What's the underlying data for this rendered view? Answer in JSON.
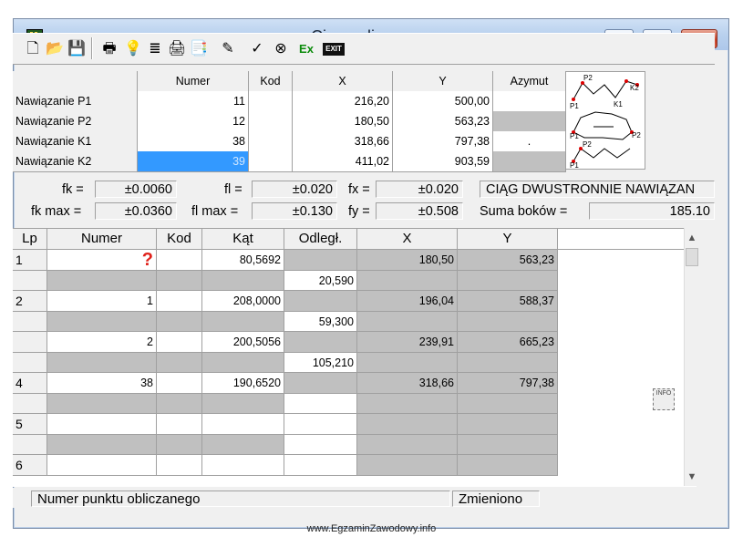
{
  "window": {
    "title": "Ciąg poligonowy",
    "controls": {
      "minimize": "–",
      "maximize": "□",
      "close": "✕"
    }
  },
  "toolbar": {
    "icons": [
      "new-file-icon",
      "open-folder-icon",
      "save-icon",
      "print-setup-icon",
      "bulb-icon",
      "list-icon",
      "printer-icon",
      "export-icon",
      "pencil-icon",
      "check-icon",
      "stop-icon",
      "excel-icon",
      "exit-icon"
    ],
    "exit_label": "EXIT",
    "excel_label": "Ex"
  },
  "connections": {
    "headers": {
      "numer": "Numer",
      "kod": "Kod",
      "x": "X",
      "y": "Y",
      "azymut": "Azymut"
    },
    "rows": [
      {
        "label": "Nawiązanie P1",
        "numer": "11",
        "kod": "",
        "x": "216,20",
        "y": "500,00",
        "azymut": ""
      },
      {
        "label": "Nawiązanie P2",
        "numer": "12",
        "kod": "",
        "x": "180,50",
        "y": "563,23",
        "azymut": ""
      },
      {
        "label": "Nawiązanie K1",
        "numer": "38",
        "kod": "",
        "x": "318,66",
        "y": "797,38",
        "azymut": "."
      },
      {
        "label": "Nawiązanie K2",
        "numer": "39",
        "kod": "",
        "x": "411,02",
        "y": "903,59",
        "azymut": ""
      }
    ],
    "diagram_labels": {
      "p1": "P1",
      "p2": "P2",
      "k1": "K1",
      "k2": "K2"
    }
  },
  "stats": {
    "fk_label": "fk =",
    "fk": "±0.0060",
    "fl_label": "fl =",
    "fl": "±0.020",
    "fx_label": "fx =",
    "fx": "±0.020",
    "type": "CIĄG DWUSTRONNIE NAWIĄZAN",
    "fkmax_label": "fk max =",
    "fkmax": "±0.0360",
    "flmax_label": "fl max =",
    "flmax": "±0.130",
    "fy_label": "fy =",
    "fy": "±0.508",
    "suma_label": "Suma boków =",
    "suma": "185.10"
  },
  "traverse": {
    "headers": {
      "lp": "Lp",
      "numer": "Numer",
      "kod": "Kod",
      "kat": "Kąt",
      "odleg": "Odległ.",
      "x": "X",
      "y": "Y"
    },
    "rows": [
      {
        "lp": "1",
        "numer": "?",
        "kod": "",
        "kat": "80,5692",
        "odleg": "",
        "x": "180,50",
        "y": "563,23"
      },
      {
        "lp": "",
        "numer": "",
        "kod": "",
        "kat": "",
        "odleg": "20,590",
        "x": "",
        "y": ""
      },
      {
        "lp": "2",
        "numer": "1",
        "kod": "",
        "kat": "208,0000",
        "odleg": "",
        "x": "196,04",
        "y": "588,37"
      },
      {
        "lp": "",
        "numer": "",
        "kod": "",
        "kat": "",
        "odleg": "59,300",
        "x": "",
        "y": ""
      },
      {
        "lp": "3",
        "numer": "2",
        "kod": "",
        "kat": "200,5056",
        "odleg": "",
        "x": "239,91",
        "y": "665,23"
      },
      {
        "lp": "",
        "numer": "",
        "kod": "",
        "kat": "",
        "odleg": "105,210",
        "x": "",
        "y": ""
      },
      {
        "lp": "4",
        "numer": "38",
        "kod": "",
        "kat": "190,6520",
        "odleg": "",
        "x": "318,66",
        "y": "797,38"
      },
      {
        "lp": "",
        "numer": "",
        "kod": "",
        "kat": "",
        "odleg": "",
        "x": "",
        "y": ""
      },
      {
        "lp": "5",
        "numer": "",
        "kod": "",
        "kat": "",
        "odleg": "",
        "x": "",
        "y": ""
      },
      {
        "lp": "",
        "numer": "",
        "kod": "",
        "kat": "",
        "odleg": "",
        "x": "",
        "y": ""
      },
      {
        "lp": "6",
        "numer": "",
        "kod": "",
        "kat": "",
        "odleg": "",
        "x": "",
        "y": ""
      }
    ],
    "info_label": "INFO"
  },
  "status": {
    "hint": "Numer punktu obliczanego",
    "state": "Zmieniono"
  },
  "footer": "www.EgzaminZawodowy.info",
  "colors": {
    "selection": "#3399ff",
    "gray_cell": "#c0c0c0",
    "question_mark": "#e0221b"
  }
}
